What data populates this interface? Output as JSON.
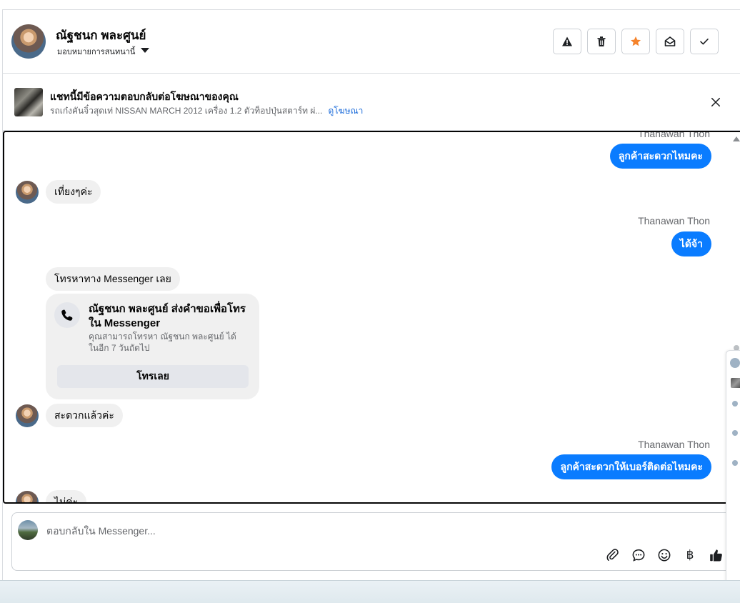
{
  "header": {
    "contact_name": "ณัฐชนก พละศูนย์",
    "assign_label": "มอบหมายการสนทนานี้",
    "tools": [
      "warning-icon",
      "trash-icon",
      "star-icon",
      "mark-unread-icon",
      "check-icon"
    ],
    "star_color": "#f5832b"
  },
  "ad_banner": {
    "title": "แชทนี้มีข้อความตอบกลับต่อโฆษณาของคุณ",
    "description": "รถเก๋งคันจิ๋วสุดเท่ NISSAN MARCH 2012 เครื่อง 1.2 ตัวท็อปปุ่นสตาร์ท ผ่...",
    "view_ad_link": "ดูโฆษณา"
  },
  "messages": {
    "m1_sender": "Thanawan Thon",
    "m1_text": "ลูกค้าสะดวกไหมคะ",
    "m2_text": "เที่ยงๆค่ะ",
    "m3_sender": "Thanawan Thon",
    "m3_text": "ได้จ้า",
    "m4_text": "โทรหาทาง Messenger เลย",
    "m5_text": "สะดวกแล้วค่ะ",
    "m6_sender": "Thanawan Thon",
    "m6_text": "ลูกค้าสะดวกให้เบอร์ติดต่อไหมคะ",
    "m7_text": "ไม่ค่ะ"
  },
  "call_card": {
    "title": "ณัฐชนก พละศูนย์ ส่งคำขอเพื่อโทรใน Messenger",
    "description": "คุณสามารถโทรหา ณัฐชนก พละศูนย์ ได้ในอีก 7 วันถัดไป",
    "button_label": "โทรเลย"
  },
  "composer": {
    "placeholder": "ตอบกลับใน Messenger...",
    "currency_symbol": "฿"
  },
  "colors": {
    "outgoing_bubble": "#0a7cff",
    "incoming_bubble": "#f0f0f0",
    "link": "#216fdb"
  }
}
